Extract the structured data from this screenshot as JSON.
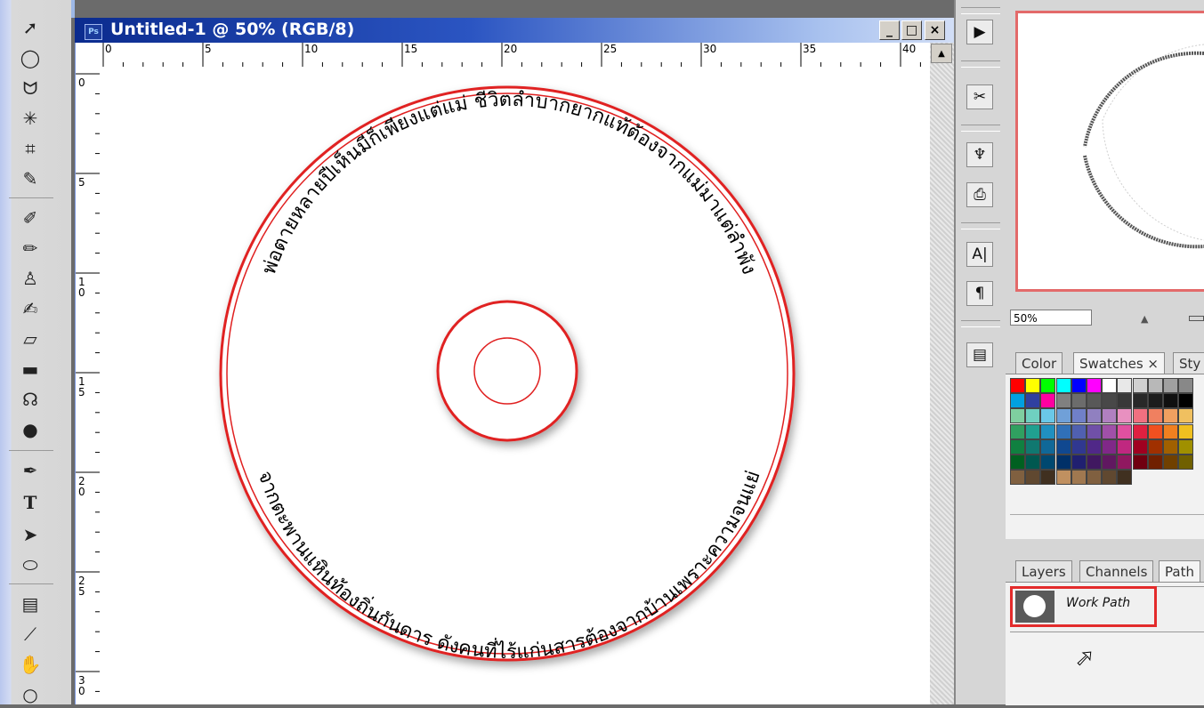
{
  "document": {
    "title": "Untitled-1 @ 50% (RGB/8)",
    "app_icon": "Ps",
    "ruler_h_labels": [
      "0",
      "5",
      "10",
      "15",
      "20",
      "25",
      "30",
      "35",
      "40"
    ],
    "ruler_v_labels": [
      "0",
      "5",
      "1\n0",
      "1\n5",
      "2\n0",
      "2\n5",
      "3\n0"
    ],
    "window_buttons": [
      "_",
      "□",
      "×"
    ]
  },
  "canvas": {
    "circle_text_top": "พ่อตายหลายปีเห็นมีก็เพียงแต่แม่ ชีวิตลำบากยากแท้ต้องจากแม่มาแต่ลำพัง",
    "circle_text_bottom": "จากตะพานแหินท้องถิ่นกันดาร ดังคนที่ไร้แก่นสารต้องจากบ้านเพราะความจนแย่",
    "ring_color": "#e02020"
  },
  "navigator": {
    "zoom": "50%"
  },
  "swatches_panel": {
    "tabs": [
      "Color",
      "Swatches ×",
      "Sty"
    ],
    "colors": [
      [
        "#ff0000",
        "#ffff00",
        "#00ff00",
        "#00ffff",
        "#0000ff",
        "#ff00ff",
        "#ffffff",
        "#e8e8e8",
        "#d0d0d0",
        "#b8b8b8",
        "#a0a0a0",
        "#888888"
      ],
      [
        "#00a0e0",
        "#3040a0",
        "#ff00a0",
        "#808080",
        "#6c6c6c",
        "#585858",
        "#484848",
        "#383838",
        "#282828",
        "#1c1c1c",
        "#101010",
        "#000000"
      ],
      [
        "#7fcfa0",
        "#6fd0c0",
        "#6ac8e8",
        "#70a0d8",
        "#7080c8",
        "#9080c0",
        "#b080c0",
        "#e890c0",
        "#f07080",
        "#f08060",
        "#f0a060",
        "#f0c060"
      ],
      [
        "#30a060",
        "#20a090",
        "#2090c0",
        "#3070b8",
        "#5060b0",
        "#7050a8",
        "#a050a8",
        "#e050a0",
        "#e02040",
        "#f05020",
        "#f08020",
        "#f0c020"
      ],
      [
        "#108040",
        "#107870",
        "#106898",
        "#104890",
        "#303890",
        "#502888",
        "#802888",
        "#c02880",
        "#a00020",
        "#a03000",
        "#a06000",
        "#a09000"
      ],
      [
        "#006020",
        "#005850",
        "#004870",
        "#003068",
        "#202070",
        "#401860",
        "#601860",
        "#901860",
        "#700010",
        "#702000",
        "#704000",
        "#706000"
      ],
      [
        "#806040",
        "#604830",
        "#403020",
        "#c09060",
        "#a07850",
        "#806040",
        "#604830",
        "#403020"
      ]
    ]
  },
  "layers_panel": {
    "tabs": [
      "Layers",
      "Channels",
      "Path"
    ],
    "work_path_label": "Work Path"
  }
}
